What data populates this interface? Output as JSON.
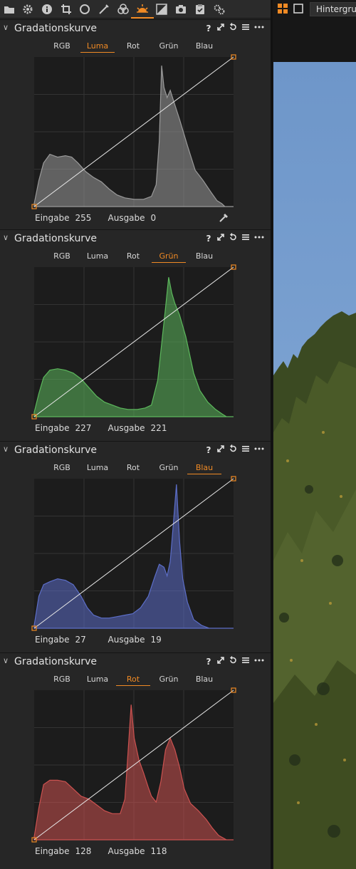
{
  "toolbar": {
    "icons": [
      "folder-icon",
      "gear-icon",
      "info-icon",
      "crop-icon",
      "lens-icon",
      "adjust-icon",
      "color-icon",
      "exposure-icon",
      "details-icon",
      "camera-icon",
      "metadata-icon",
      "batch-icon"
    ],
    "active_icon": "exposure-icon",
    "accent": "#f08a24"
  },
  "viewer": {
    "grid_icon": "grid-view-icon",
    "single_icon": "single-view-icon",
    "field_text": "Hintergrun"
  },
  "panels": [
    {
      "title": "Gradationskurve",
      "tabs": [
        "RGB",
        "Luma",
        "Rot",
        "Grün",
        "Blau"
      ],
      "active_tab": "Luma",
      "histogram_color": "#9a9a9a",
      "input_label": "Eingabe",
      "input_value": "255",
      "output_label": "Ausgabe",
      "output_value": "0"
    },
    {
      "title": "Gradationskurve",
      "tabs": [
        "RGB",
        "Luma",
        "Rot",
        "Grün",
        "Blau"
      ],
      "active_tab": "Grün",
      "histogram_color": "#5cb85c",
      "input_label": "Eingabe",
      "input_value": "227",
      "output_label": "Ausgabe",
      "output_value": "221"
    },
    {
      "title": "Gradationskurve",
      "tabs": [
        "RGB",
        "Luma",
        "Rot",
        "Grün",
        "Blau"
      ],
      "active_tab": "Blau",
      "histogram_color": "#5c6ec8",
      "input_label": "Eingabe",
      "input_value": "27",
      "output_label": "Ausgabe",
      "output_value": "19"
    },
    {
      "title": "Gradationskurve",
      "tabs": [
        "RGB",
        "Luma",
        "Rot",
        "Grün",
        "Blau"
      ],
      "active_tab": "Rot",
      "histogram_color": "#cc5250",
      "input_label": "Eingabe",
      "input_value": "128",
      "output_label": "Ausgabe",
      "output_value": "118"
    }
  ]
}
